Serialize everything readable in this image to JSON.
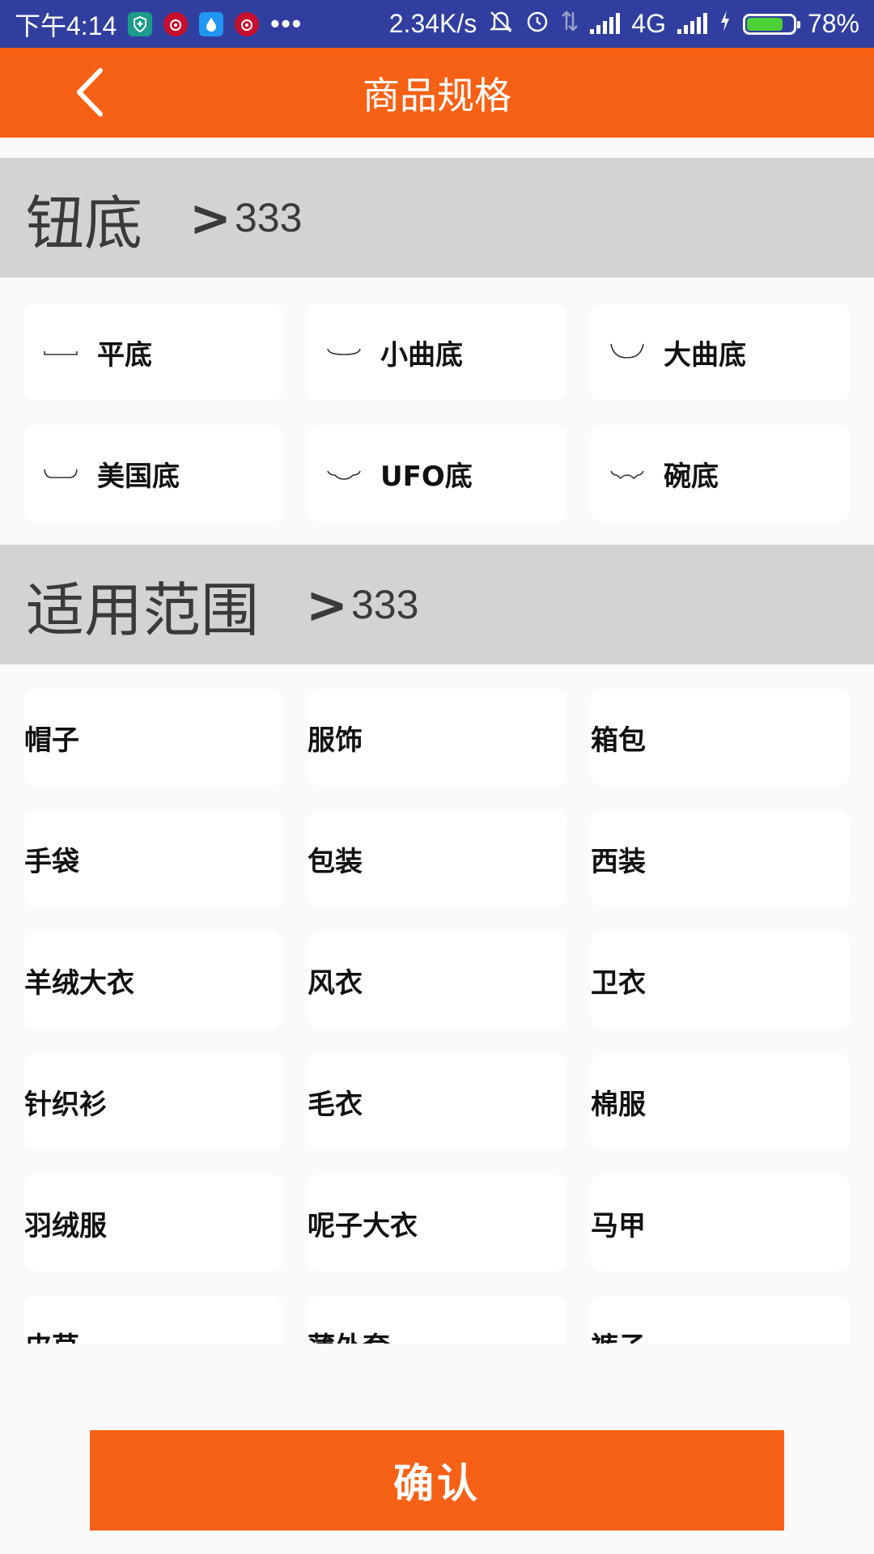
{
  "status_bar": {
    "time": "下午4:14",
    "more": "•••",
    "speed": "2.34K/s",
    "network": "4G",
    "battery": "78%",
    "battery_level": 0.78
  },
  "app_bar": {
    "title": "商品规格"
  },
  "sections": [
    {
      "title": "钮底",
      "arrow": ">",
      "count": "333",
      "options": [
        {
          "label": "平底",
          "icon": "flat-bottom-icon"
        },
        {
          "label": "小曲底",
          "icon": "slight-curve-bottom-icon"
        },
        {
          "label": "大曲底",
          "icon": "large-curve-bottom-icon"
        },
        {
          "label": "美国底",
          "icon": "american-bottom-icon"
        },
        {
          "label": "UFO底",
          "icon": "ufo-bottom-icon"
        },
        {
          "label": "碗底",
          "icon": "bowl-bottom-icon"
        }
      ]
    },
    {
      "title": "适用范围",
      "arrow": ">",
      "count": "333",
      "options": [
        {
          "label": "帽子"
        },
        {
          "label": "服饰"
        },
        {
          "label": "箱包"
        },
        {
          "label": "手袋"
        },
        {
          "label": "包装"
        },
        {
          "label": "西装"
        },
        {
          "label": "羊绒大衣"
        },
        {
          "label": "风衣"
        },
        {
          "label": "卫衣"
        },
        {
          "label": "针织衫"
        },
        {
          "label": "毛衣"
        },
        {
          "label": "棉服"
        },
        {
          "label": "羽绒服"
        },
        {
          "label": "呢子大衣"
        },
        {
          "label": "马甲"
        },
        {
          "label": "皮草"
        },
        {
          "label": "薄外套"
        },
        {
          "label": "裤子"
        }
      ]
    }
  ],
  "confirm_label": "确认",
  "colors": {
    "accent": "#f76115",
    "status_bar": "#303f9f",
    "section_header": "#d3d3d3",
    "page_bg": "#fafafa"
  }
}
